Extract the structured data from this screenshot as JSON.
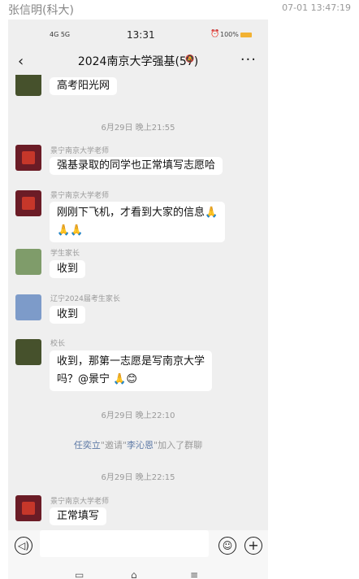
{
  "post": {
    "poster": "张信明(科大)",
    "time": "07-01 13:47:19"
  },
  "status_bar": {
    "signal": "4G 5G",
    "clock": "13:31",
    "battery": "100%"
  },
  "chat": {
    "title": "2024南京大学强基(57)"
  },
  "messages": [
    {
      "type": "msg",
      "sender": "",
      "text": "高考阳光网"
    },
    {
      "type": "time",
      "text": "6月29日 晚上21:55"
    },
    {
      "type": "msg",
      "sender": "景宁南京大学老师",
      "text": "强基录取的同学也正常填写志愿哈"
    },
    {
      "type": "msg",
      "sender": "景宁南京大学老师",
      "text_line1": "刚刚下飞机，才看到大家的信息🙏",
      "text_line2": "🙏🙏"
    },
    {
      "type": "msg",
      "sender": "学生家长",
      "text": "收到"
    },
    {
      "type": "msg",
      "sender": "辽宁2024届考生家长",
      "text": "收到"
    },
    {
      "type": "msg",
      "sender": "校长",
      "text_line1": "收到，那第一志愿是写南京大学",
      "text_line2": "吗？@景宁 🙏😊"
    },
    {
      "type": "time",
      "text": "6月29日 晚上22:10"
    },
    {
      "type": "join",
      "inviter": "任奕立",
      "mid": "\"邀请\"",
      "invitee": "李沁恩",
      "tail": "\"加入了群聊"
    },
    {
      "type": "time",
      "text": "6月29日 晚上22:15"
    },
    {
      "type": "msg",
      "sender": "景宁南京大学老师",
      "text": "正常填写"
    }
  ],
  "colors": {
    "chat_bg": "#efefef",
    "bubble": "#ffffff",
    "link": "#5d79a6"
  },
  "icons": [
    "back-icon",
    "more-icon",
    "voice-icon",
    "emoji-icon",
    "plus-icon"
  ]
}
